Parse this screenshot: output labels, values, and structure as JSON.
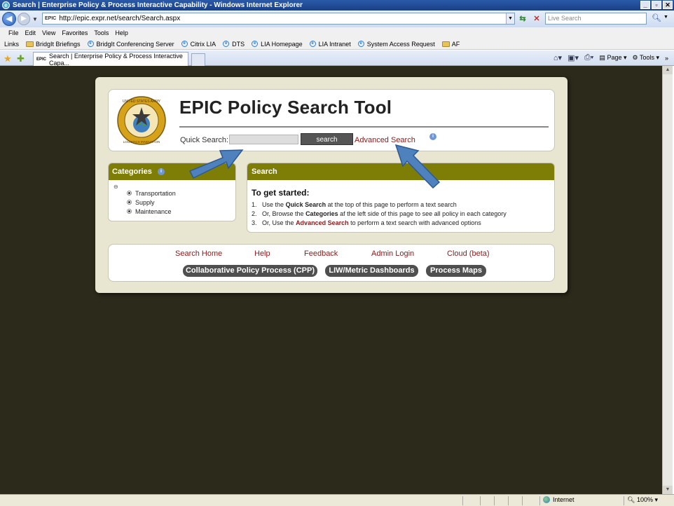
{
  "window": {
    "title": "Search | Enterprise Policy & Process Interactive Capability - Windows Internet Explorer",
    "min": "_",
    "max": "▫",
    "close": "✕"
  },
  "address": {
    "url": "http://epic.expr.net/search/Search.aspx",
    "live_search_placeholder": "Live Search"
  },
  "menu": [
    "File",
    "Edit",
    "View",
    "Favorites",
    "Tools",
    "Help"
  ],
  "links_bar": {
    "label": "Links",
    "items": [
      {
        "label": "BridgIt Briefings",
        "icon": "folder-icon"
      },
      {
        "label": "BridgIt Conferencing Server",
        "icon": "ie-icon"
      },
      {
        "label": "Citrix LIA",
        "icon": "ie-icon"
      },
      {
        "label": "DTS",
        "icon": "ie-icon"
      },
      {
        "label": "LIA Homepage",
        "icon": "ie-icon"
      },
      {
        "label": "LIA Intranet",
        "icon": "ie-icon"
      },
      {
        "label": "System Access Request",
        "icon": "ie-icon"
      },
      {
        "label": "AF",
        "icon": "folder-icon"
      }
    ]
  },
  "tab": {
    "title": "Search | Enterprise Policy & Process Interactive Capa...",
    "site_icon": "EPIC"
  },
  "command_bar": {
    "page": "Page",
    "tools": "Tools"
  },
  "page": {
    "title": "EPIC Policy Search Tool",
    "logo_text": "United States Army · Logistics Innovation Agency",
    "quick_search_label": "Quick Search:",
    "search_button": "search",
    "advanced_search": "Advanced Search",
    "categories": {
      "heading": "Categories",
      "items": [
        "Transportation",
        "Supply",
        "Maintenance"
      ]
    },
    "search_panel": {
      "heading": "Search",
      "get_started": "To get started:",
      "steps": [
        {
          "num": "1.",
          "pre": "Use the ",
          "bold": "Quick Search",
          "post": " at the top of this page to perform a text search"
        },
        {
          "num": "2.",
          "pre": "Or, Browse the ",
          "bold": "Categories",
          "post": " af the left side of this page to see all policy in each category"
        },
        {
          "num": "3.",
          "pre": "Or, Use the ",
          "bold": "Advanced Search",
          "post": " to perform a text search with advanced options"
        }
      ]
    },
    "footer_links": [
      "Search Home",
      "Help",
      "Feedback",
      "Admin Login",
      "Cloud (beta)"
    ],
    "footer_buttons": [
      "Collaborative Policy Process (CPP)",
      "LIW/Metric Dashboards",
      "Process Maps"
    ]
  },
  "status": {
    "zone": "Internet",
    "zoom": "100%"
  },
  "colors": {
    "page_background": "#2b2a1b",
    "card_header": "#7e7e07",
    "link_red": "#8b1a1a",
    "annotation_arrow": "#4f81bd"
  }
}
